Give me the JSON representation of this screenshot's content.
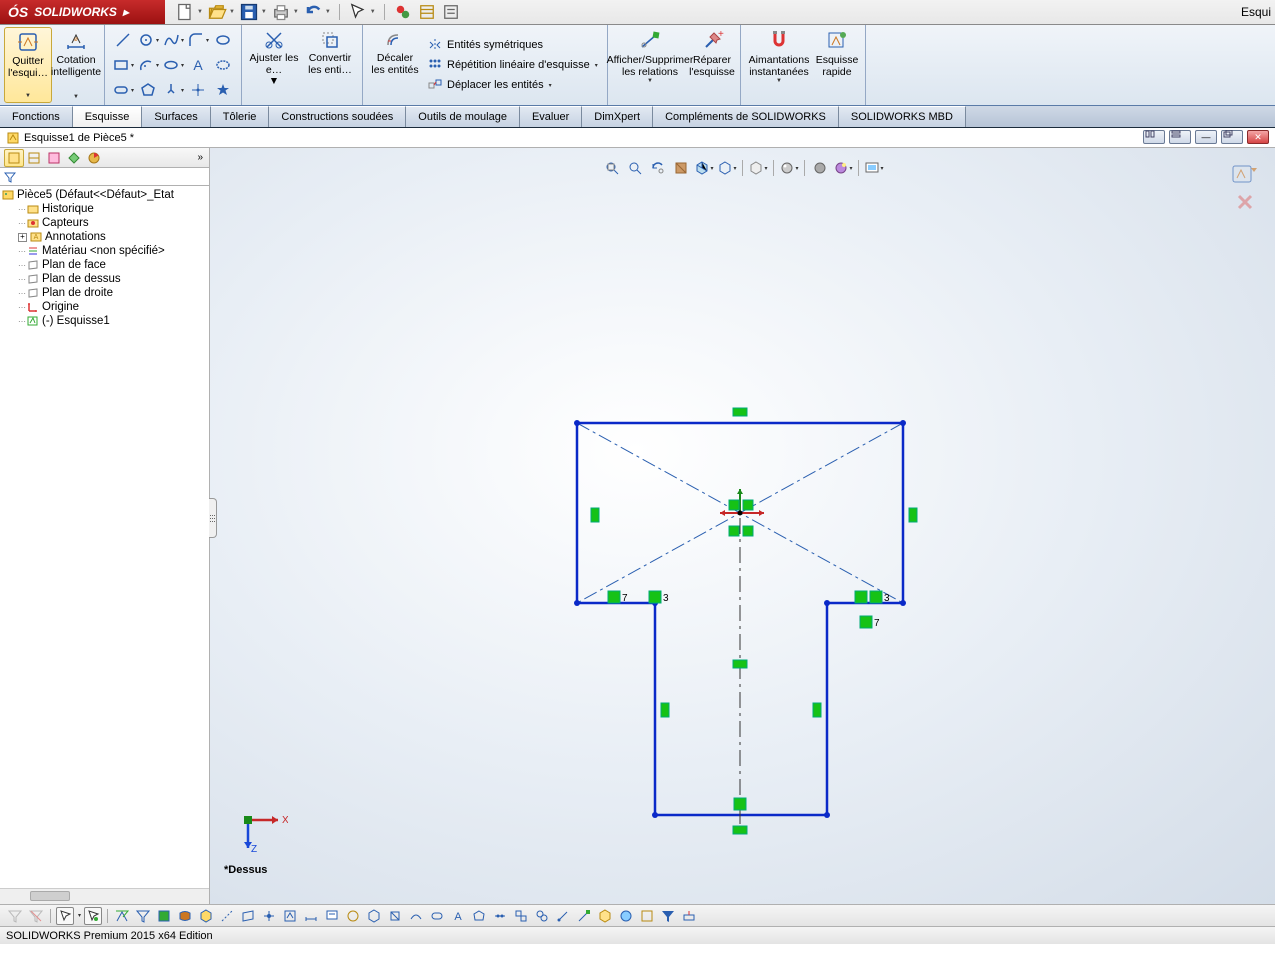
{
  "titlebar": {
    "logo_text": "SOLIDWORKS",
    "right_text": "Esqui"
  },
  "ribbon": {
    "exit_sketch": "Quitter l'esqui…",
    "smart_dim": "Cotation intelligente",
    "trim": "Ajuster les e…",
    "convert": "Convertir les enti…",
    "offset": "Décaler les entités",
    "mirror": "Entités symétriques",
    "linear": "Répétition linéaire d'esquisse",
    "move": "Déplacer les entités",
    "display_relations": "Afficher/Supprimer les relations",
    "repair": "Réparer l'esquisse",
    "snaps": "Aimantations instantanées",
    "rapid": "Esquisse rapide"
  },
  "tabs": [
    "Fonctions",
    "Esquisse",
    "Surfaces",
    "Tôlerie",
    "Constructions soudées",
    "Outils de moulage",
    "Evaluer",
    "DimXpert",
    "Compléments de SOLIDWORKS",
    "SOLIDWORKS MBD"
  ],
  "active_tab_index": 1,
  "doc_title": "Esquisse1 de Pièce5 *",
  "tree": {
    "root": "Pièce5  (Défaut<<Défaut>_Etat",
    "items": [
      "Historique",
      "Capteurs",
      "Annotations",
      "Matériau <non spécifié>",
      "Plan de face",
      "Plan de dessus",
      "Plan de droite",
      "Origine",
      "(-) Esquisse1"
    ]
  },
  "triad": {
    "x": "X",
    "z": "Z",
    "label": "*Dessus"
  },
  "sketch_markers": {
    "s3": "3",
    "s7": "7"
  },
  "status": "SOLIDWORKS Premium 2015 x64 Edition"
}
